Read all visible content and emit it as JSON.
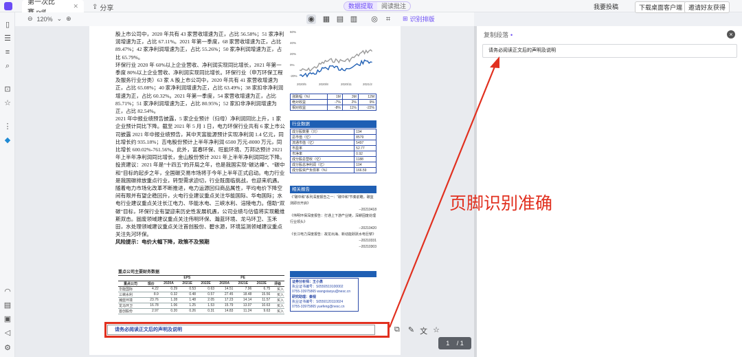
{
  "titlebar": {
    "tab_title": "第一次比赛.pdf",
    "share_label": "分享",
    "mode_tabs": [
      "数据提取",
      "阅读批注"
    ],
    "login": "我要投稿",
    "download": "下载桌面客户端",
    "vip": "邀请好友获得"
  },
  "toolbar": {
    "zoom": "120%",
    "ocr_label": "识别排版"
  },
  "doc": {
    "paragraphs": [
      "股上市公司中，2020 年共有 43 家营收增速为正，占比 56.58%；51 家净利润增速为正，占比 67.11%。2021 年第一季度，68 家营收增速为正，占比 89.47%；42 家净利润增速为正，占比 55.26%；50 家净利润增速为正，占比 65.79%。",
      "环保行业 2020 年 60%以上企业营收、净利润实现同比增长，2021 年第一季度 80%以上企业营收、净利润实现同比增长。环保行业（申万环保工程及服务行业分类）63 家 A 股上市公司中，2020 年共有 41 家营收增速为正，占比 65.08%；40 家净利润增速为正，占比 63.49%；38 家扣非净利润增速为正，占比 60.32%。2021 年第一季度，54 家营收增速为正，占比 85.71%；51 家净利润增速为正，占比 80.95%；52 家扣非净利润增速为正，占比 82.54%。",
      "2021 年中报业绩预告披露，5 家企业预计（归母）净利润同比上升，1 家企业预计同比下降。截至 2021 年 5 月 1 日，电力环保行业共有 6 家上市公司披露 2021 年中报业绩预告，其中天富能源预计实现净利润 1.4 亿元，同比增长约 935.18%；吉电股份预计上半年净利润 6500 万元-8000 万元，同比增长 600.02%-761.56%。此外，富春环保、旺能环境、万邦达预计 2021 年上半年净利润同比增长，金山股份预计 2021 年上半年净利润同比下降。",
      "投资建议：2021 年是“十四五”的开局之年，也是我国实现“碳达峰”、“碳中和”目标的起步之年，全国碳交易市场将于今年上半年正式启动。电力行业是我国碳排放重点行业，转型需求迫切，行业既面临挑战，也迎来机遇。随着电力市场化改革不断推进，电力运源回归商品属性，平均电价下降空间有限并有望企稳回升，火电行业建议重点关注华能国际、华电国际；水电行业建议重点关注长江电力、华能水电、三峡水利、涪陵电力。借助“双碳”目标，环保行业有望迎来历史性发展机遇，公司业绩与估值将实现戴维斯双击。固废领域建议重点关注伟明环保、瀚蓝环境、龙马环卫、玉禾田，水处理领域建议重点关注首创股份、碧水源，环境监测领域建议重点关注先河环保。",
      "风险提示：电价大幅下降，政策不及预期"
    ],
    "fin_title": "重点公司主要财务数据",
    "fin_header": [
      "重点公司",
      "现价",
      "2020A",
      "2021E",
      "2022E",
      "2020A",
      "2021E",
      "2022E",
      "评级"
    ],
    "fin_group": [
      "EPS",
      "PE"
    ],
    "fin_rows": [
      [
        "华能国际",
        "4.22",
        "0.29",
        "0.53",
        "0.63",
        "14.51",
        "7.96",
        "6.75",
        "买入"
      ],
      [
        "三峡水利",
        "8.9",
        "0.32",
        "0.48",
        "0.57",
        "27.45",
        "18.48",
        "15.56",
        "买入"
      ],
      [
        "瀚蓝环境",
        "23.76",
        "1.28",
        "1.48",
        "2.05",
        "17.23",
        "14.14",
        "11.57",
        "买入"
      ],
      [
        "龙马环卫",
        "16.78",
        "1.06",
        "1.25",
        "1.53",
        "15.79",
        "13.07",
        "10.63",
        "买入"
      ],
      [
        "首创股份",
        "2.97",
        "0.20",
        "0.26",
        "0.31",
        "14.83",
        "11.24",
        "9.63",
        "买入"
      ]
    ],
    "footer_text": "请务必阅读正文后的声明及说明",
    "perf_rows": [
      [
        "涨跌幅（%）",
        "1M",
        "3M",
        "12M"
      ],
      [
        "绝对收益",
        "-7%",
        "2%",
        "9%"
      ],
      [
        "相对收益",
        "-8%",
        "11%",
        "-22%"
      ]
    ],
    "chart_xticks": [
      "2020/5",
      "2020/8",
      "2020/11",
      "2021/2"
    ],
    "chart_yticks": [
      "60%",
      "40%",
      "20%",
      "0%",
      "-20%"
    ],
    "ind_title": "行业数据",
    "ind_rows": [
      [
        "成分股数量（只）",
        "194"
      ],
      [
        "总市值（亿）",
        "8579"
      ],
      [
        "流通市值（亿）",
        "5497"
      ],
      [
        "市盈率",
        "52.77"
      ],
      [
        "市净率",
        "0.92"
      ],
      [
        "成分股总营收（亿）",
        "1188"
      ],
      [
        "成分股总净利润（亿）",
        "104"
      ],
      [
        "成分股资产负债率（%）",
        "166.59"
      ]
    ],
    "rel_title": "相关报告",
    "rel_items": [
      [
        "《“碳中和”系列深度报告之一：“碳中和”节奏前瞻，碳监测即日开启》",
        "--20210418"
      ],
      [
        "《伟明环保深度报告：打通上下游产业链，深耕固废处理行业领头》",
        "--20210420"
      ],
      [
        "《长江电力深度报告：故龙出海、新动能跃跃水电巨擘》",
        "--20210331"
      ],
      [
        "",
        "--20210303"
      ]
    ],
    "analyst_lines": [
      "证券分析师：王小勇",
      "执业证书编号：S0550519100002",
      "0755-33975865    wangxiaoyu@nesc.cn",
      "研究助理：秦视",
      "执业证书编号：S0550120110024",
      "0755-33975865    yuefeng@nesc.cn"
    ]
  },
  "right_panel": {
    "title": "复制段落",
    "content": "请务必阅读正文后的声明及说明"
  },
  "annotation": "页脚识别准确",
  "pager": {
    "current": "1",
    "total": "/ 1"
  },
  "colors": {
    "accent": "#6b4cf5",
    "annotation_red": "#e1301f",
    "report_blue": "#1f5fb4"
  }
}
